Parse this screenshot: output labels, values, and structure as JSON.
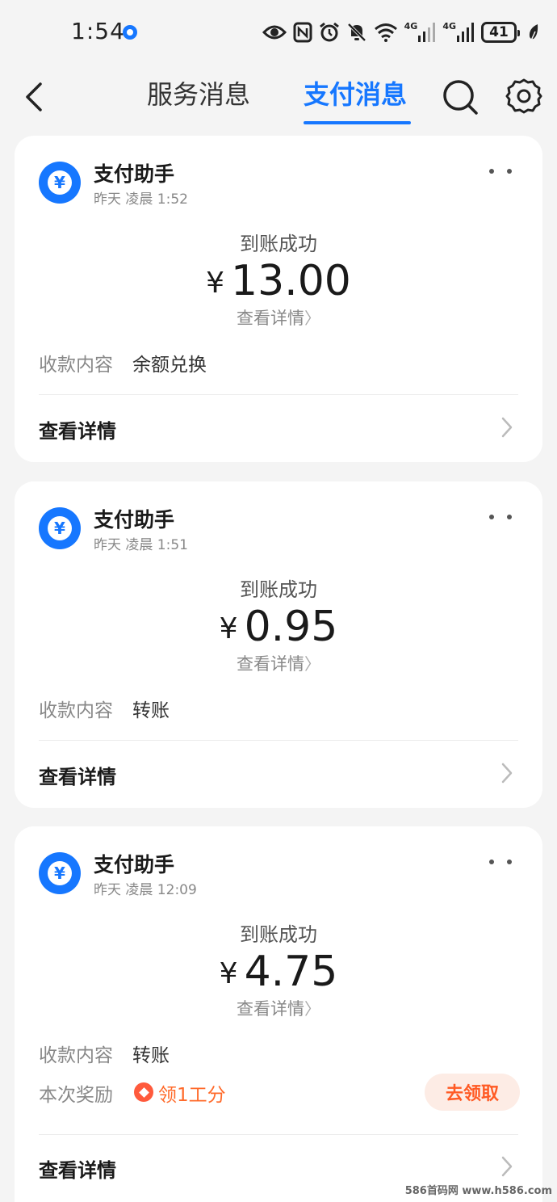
{
  "status_bar": {
    "time": "1:54",
    "network_1": "4G",
    "network_2": "4G",
    "battery": "41",
    "icons": [
      "eye-icon",
      "nfc-icon",
      "alarm-icon",
      "mute-icon",
      "wifi-icon",
      "signal-icon",
      "signal-icon",
      "battery-icon",
      "leaf-icon"
    ]
  },
  "header": {
    "tabs": [
      {
        "label": "服务消息",
        "active": false
      },
      {
        "label": "支付消息",
        "active": true
      }
    ],
    "accent_color": "#1677ff"
  },
  "messages": [
    {
      "sender": "支付助手",
      "time": "昨天 凌晨 1:52",
      "status": "到账成功",
      "currency": "¥",
      "amount": "13.00",
      "detail_link": "查看详情",
      "content_label": "收款内容",
      "content_value": "余额兑换",
      "footer_link": "查看详情"
    },
    {
      "sender": "支付助手",
      "time": "昨天 凌晨 1:51",
      "status": "到账成功",
      "currency": "¥",
      "amount": "0.95",
      "detail_link": "查看详情",
      "content_label": "收款内容",
      "content_value": "转账",
      "footer_link": "查看详情"
    },
    {
      "sender": "支付助手",
      "time": "昨天 凌晨 12:09",
      "status": "到账成功",
      "currency": "¥",
      "amount": "4.75",
      "detail_link": "查看详情",
      "content_label": "收款内容",
      "content_value": "转账",
      "reward_label": "本次奖励",
      "reward_value": "领1工分",
      "claim_button": "去领取",
      "footer_link": "查看详情"
    }
  ],
  "watermark": "586首码网 www.h586.com"
}
